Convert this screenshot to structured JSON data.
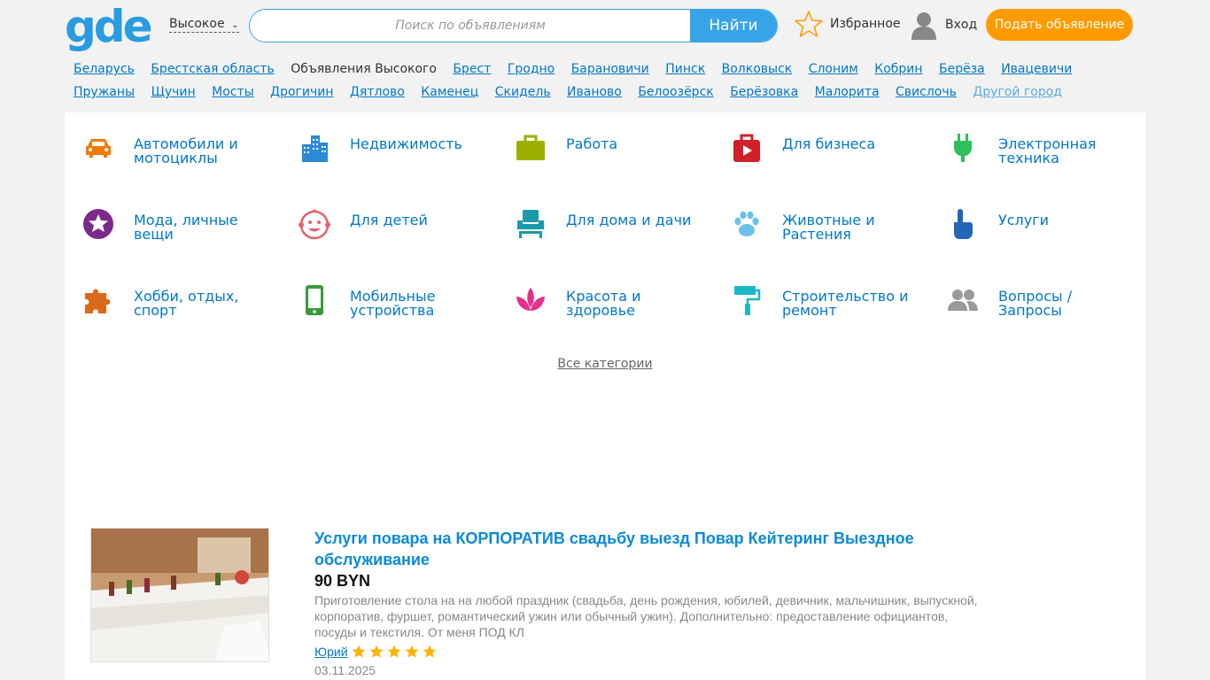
{
  "header": {
    "logo": "gde",
    "city": "Высокое",
    "search_placeholder": "Поиск по объявлениям",
    "search_button": "Найти",
    "favorites": "Избранное",
    "login": "Вход",
    "post_ad": "Подать объявление"
  },
  "cities": {
    "links1": [
      "Беларусь",
      "Брестская область"
    ],
    "current": "Объявления Высокого",
    "links2": [
      "Брест",
      "Гродно",
      "Барановичи",
      "Пинск",
      "Волковыск",
      "Слоним",
      "Кобрин",
      "Берёза",
      "Ивацевичи",
      "Пружаны",
      "Щучин",
      "Мосты",
      "Дрогичин",
      "Дятлово",
      "Каменец",
      "Скидель",
      "Иваново",
      "Белоозёрск",
      "Берёзовка",
      "Малорита",
      "Свислочь"
    ],
    "other": "Другой город"
  },
  "categories": [
    {
      "label": "Автомобили и мотоциклы",
      "icon": "car-icon",
      "color": "#f07a00"
    },
    {
      "label": "Недвижимость",
      "icon": "buildings-icon",
      "color": "#2b8ad6"
    },
    {
      "label": "Работа",
      "icon": "briefcase-icon",
      "color": "#9bb000"
    },
    {
      "label": "Для бизнеса",
      "icon": "play-briefcase-icon",
      "color": "#d0202a"
    },
    {
      "label": "Электронная техника",
      "icon": "plug-icon",
      "color": "#2ec05a"
    },
    {
      "label": "Мода, личные вещи",
      "icon": "star-circle-icon",
      "color": "#7b2a8a"
    },
    {
      "label": "Для детей",
      "icon": "baby-face-icon",
      "color": "#e8606a"
    },
    {
      "label": "Для дома и дачи",
      "icon": "armchair-icon",
      "color": "#1a9aa8"
    },
    {
      "label": "Животные и Растения",
      "icon": "paw-icon",
      "color": "#6cc0ec"
    },
    {
      "label": "Услуги",
      "icon": "pointing-hand-icon",
      "color": "#2366b8"
    },
    {
      "label": "Хобби, отдых, спорт",
      "icon": "puzzle-icon",
      "color": "#d86a1a"
    },
    {
      "label": "Мобильные устройства",
      "icon": "smartphone-icon",
      "color": "#3a9a3a"
    },
    {
      "label": "Красота и здоровье",
      "icon": "lotus-icon",
      "color": "#e8308a"
    },
    {
      "label": "Строительство и ремонт",
      "icon": "paint-roller-icon",
      "color": "#1ab8c8"
    },
    {
      "label": "Вопросы / Запросы",
      "icon": "people-icon",
      "color": "#9a9a9a"
    }
  ],
  "all_categories": "Все категории",
  "listing": {
    "title": "Услуги повара на КОРПОРАТИВ свадьбу выезд Повар Кейтеринг Выездное обслуживание",
    "price": "90 BYN",
    "description": "Приготовление стола на на любой праздник (свадьба, день рождения, юбилей, девичник, мальчишник, выпускной, корпоратив, фуршет, романтический ужин или обычный ужин). Дополнительно: предоставление официантов, посуды и текстиля. От меня ПОД КЛ",
    "seller": "Юрий",
    "rating": 5,
    "date": "03.11.2025"
  },
  "colors": {
    "accent": "#37a4e8",
    "post_button": "#ff9b00",
    "link": "#0078c8",
    "star": "#ffb400"
  }
}
